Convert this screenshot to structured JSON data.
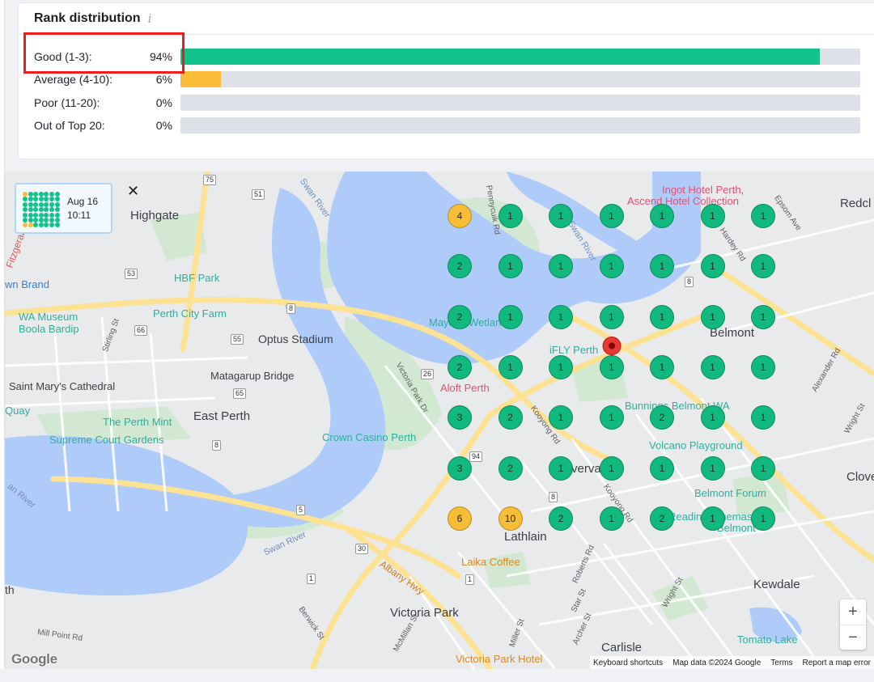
{
  "panel": {
    "title": "Rank distribution",
    "info_icon": "i",
    "rows": [
      {
        "label": "Good (1-3):",
        "pct": "94%",
        "value": 94,
        "color": "#13c28a"
      },
      {
        "label": "Average (4-10):",
        "pct": "6%",
        "value": 6,
        "color": "#fbbd3a"
      },
      {
        "label": "Poor (11-20):",
        "pct": "0%",
        "value": 0,
        "color": "#e86a5e"
      },
      {
        "label": "Out of Top 20:",
        "pct": "0%",
        "value": 0,
        "color": "#9aa0a6"
      }
    ]
  },
  "card": {
    "date": "Aug 16",
    "time": "10:11",
    "close": "✕"
  },
  "map": {
    "places": {
      "highgate": "Highgate",
      "east_perth": "East Perth",
      "belmont": "Belmont",
      "lathlain": "Lathlain",
      "victoria_park": "Victoria Park",
      "kewdale": "Kewdale",
      "carlisle": "Carlisle",
      "redcliffe": "Redcl",
      "cloverdale": "Clove",
      "rivervale": "vervale",
      "brand": "wn Brand"
    },
    "pois": {
      "ingot": "Ingot Hotel Perth,",
      "ascend": "Ascend Hotel Collection",
      "hbf": "HBF Park",
      "wa_museum": "WA Museum",
      "boola": "Boola Bardip",
      "city_farm": "Perth City Farm",
      "optus": "Optus Stadium",
      "matagarup": "Matagarup Bridge",
      "st_marys": "Saint Mary's Cathedral",
      "quay": "Quay",
      "mint": "The Perth Mint",
      "supreme": "Supreme Court Gardens",
      "crown": "Crown Casino Perth",
      "aloft": "Aloft Perth",
      "ifly": "iFLY Perth",
      "bunnings": "Bunnings Belmont WA",
      "volcano": "Volcano Playground",
      "belmont_forum": "Belmont Forum",
      "reading": "Reading Cinemas",
      "reading2": "Belmont",
      "laika": "Laika Coffee",
      "vp_hotel": "Victoria Park Hotel",
      "tomato": "Tomato Lake",
      "mayday": "Mayday Wetland",
      "th": "th"
    },
    "water": {
      "swan1": "Swan River",
      "swan2": "Swan River",
      "swan3": "Swan River",
      "swan4": "an River"
    },
    "roads": {
      "pennycuik": "Pennycuik Rd",
      "epsom": "Epsom Ave",
      "hardey": "Hardey Rd",
      "stirling": "Stirling St",
      "fitzgerald": "Fitzgeral",
      "vicpark": "Victoria Park Dr",
      "kooyong1": "Kooyong Rd",
      "kooyong2": "Kooyong Rd",
      "alexander": "Alexander Rd",
      "wright": "Wright St",
      "albany": "Albany Hwy",
      "roberts": "Roberts Rd",
      "star": "Star St",
      "archer": "Archer St",
      "miller": "Miller St",
      "berwick": "Berwick St",
      "mcmillan": "McMillan St",
      "millpoint": "Mill Point Rd",
      "wright2": "Wright St"
    },
    "route_shields": [
      "75",
      "51",
      "53",
      "8",
      "66",
      "55",
      "8",
      "26",
      "65",
      "8",
      "94",
      "5",
      "30",
      "1",
      "8",
      "1"
    ],
    "rank_pins": [
      [
        "4",
        "1",
        "1",
        "1",
        "1",
        "1",
        "1"
      ],
      [
        "2",
        "1",
        "1",
        "1",
        "1",
        "1",
        "1"
      ],
      [
        "2",
        "1",
        "1",
        "1",
        "1",
        "1",
        "1"
      ],
      [
        "2",
        "1",
        "1",
        "1",
        "1",
        "1",
        "1"
      ],
      [
        "3",
        "2",
        "1",
        "1",
        "2",
        "1",
        "1"
      ],
      [
        "3",
        "2",
        "1",
        "1",
        "1",
        "1",
        "1"
      ],
      [
        "6",
        "10",
        "2",
        "1",
        "2",
        "1",
        "1"
      ]
    ],
    "zoom_in": "+",
    "zoom_out": "−",
    "google": "Google",
    "attribution": {
      "shortcuts": "Keyboard shortcuts",
      "data": "Map data ©2024 Google",
      "terms": "Terms",
      "report": "Report a map error"
    }
  },
  "colors": {
    "good": "#13c28a",
    "average": "#fbbd3a",
    "track": "#dfe1e8",
    "highlight": "#ee1c1c"
  }
}
